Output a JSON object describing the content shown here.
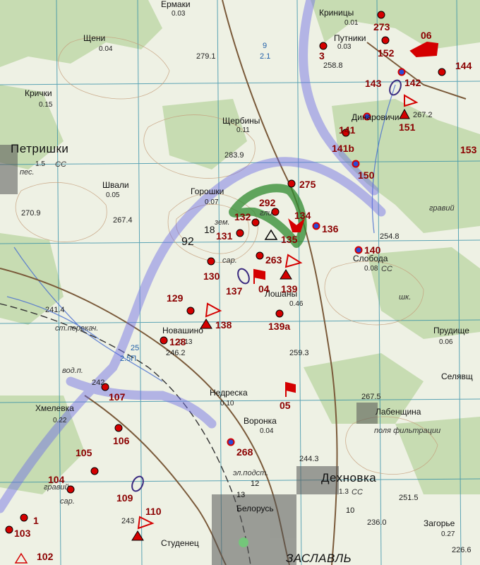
{
  "settlements": [
    {
      "id": "ermaki",
      "name": "Ермаки"
    },
    {
      "id": "krinitsy",
      "name": "Криницы"
    },
    {
      "id": "putniki",
      "name": "Путники"
    },
    {
      "id": "shcheni",
      "name": "Щени"
    },
    {
      "id": "krichki",
      "name": "Крички"
    },
    {
      "id": "shcherbiny",
      "name": "Щербины"
    },
    {
      "id": "petrishki",
      "name": "Петришки"
    },
    {
      "id": "dinarovichi",
      "name": "Динаровичи"
    },
    {
      "id": "shvali",
      "name": "Швали"
    },
    {
      "id": "goroshki",
      "name": "Горошки"
    },
    {
      "id": "sloboda",
      "name": "Слобода"
    },
    {
      "id": "loshany",
      "name": "Лошаны"
    },
    {
      "id": "prudishche",
      "name": "Прудище"
    },
    {
      "id": "novashino",
      "name": "Новашино"
    },
    {
      "id": "selyavshchina",
      "name": "Селявщ"
    },
    {
      "id": "nedreska",
      "name": "Недреска"
    },
    {
      "id": "labenshchina",
      "name": "Лабенщина"
    },
    {
      "id": "khmelevka",
      "name": "Хмелевка"
    },
    {
      "id": "voronka",
      "name": "Воронка"
    },
    {
      "id": "dekhnovka",
      "name": "Дехновка"
    },
    {
      "id": "belorus",
      "name": "Белорусь"
    },
    {
      "id": "zagorye",
      "name": "Загорье"
    },
    {
      "id": "studenets",
      "name": "Студенец"
    },
    {
      "id": "zaslavl",
      "name": "ЗАСЛАВЛЬ"
    }
  ],
  "populations": [
    "0.03",
    "0.01",
    "0.03",
    "0.04",
    "0.15",
    "0.11",
    "0.05",
    "0.07",
    "0.08",
    "0.46",
    "0.06",
    "0.13",
    "0.10",
    "0.04",
    "0.22",
    "1.3",
    "0.27",
    "1.5"
  ],
  "elevations": [
    "279.1",
    "258.8",
    "267.2",
    "283.9",
    "270.9",
    "267.4",
    "254.8",
    "241.4",
    "246.2",
    "259.3",
    "267.5",
    "242",
    "251.5",
    "236.0",
    "226.6",
    "244.3",
    "243"
  ],
  "misc_labels": [
    "поля фильтрации",
    "гравий",
    "ст.перекач.",
    "вод.п.",
    "эл.подст.",
    "сар.",
    "шк.",
    "зем.",
    "гли.",
    "пес.",
    "гравий",
    "сар.",
    "СС",
    "СС",
    "СС"
  ],
  "number_labels": [
    "92",
    "18",
    "9",
    "2.1",
    "25",
    "2.5П",
    "10",
    "12",
    "13"
  ],
  "sites": [
    "273",
    "06",
    "3",
    "152",
    "144",
    "143",
    "142",
    "141",
    "151",
    "141b",
    "153",
    "150",
    "275",
    "292",
    "132",
    "134",
    "136",
    "131",
    "135",
    "140",
    "263",
    "130",
    "137",
    "04",
    "139",
    "129",
    "138",
    "139a",
    "128",
    "107",
    "05",
    "106",
    "268",
    "105",
    "104",
    "109",
    "110",
    "1",
    "103",
    "102"
  ],
  "colors": {
    "site_fill": "#d40000",
    "blue_dot": "#2a4bd6",
    "forest": "#c7dcb2",
    "river": "#6a6ae6",
    "contour": "#c49d7a",
    "road": "#7a5a3a",
    "highlight_zone": "#2f8a2f",
    "label": "#8b0000"
  }
}
